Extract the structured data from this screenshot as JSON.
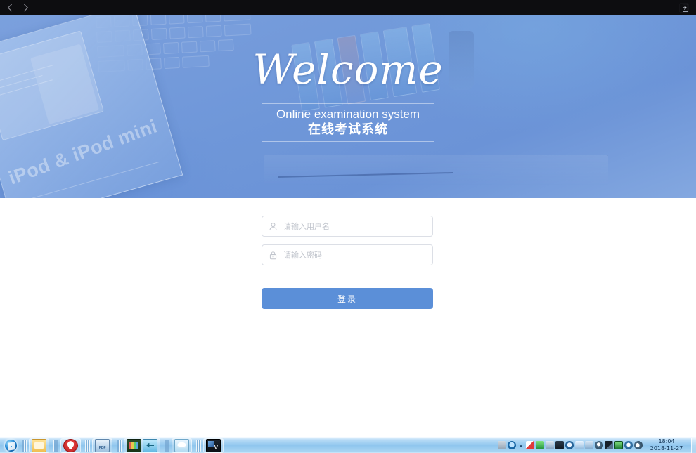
{
  "topbar": {
    "back_icon": "chevron-left-icon",
    "forward_icon": "chevron-right-icon",
    "exit_icon": "exit-fullscreen-icon"
  },
  "hero": {
    "welcome_script": "Welcome",
    "title_en": "Online examination system",
    "title_cn": "在线考试系统",
    "background_color": "#6f96d8",
    "photo_text": "iPod & iPod mini"
  },
  "login": {
    "username": {
      "icon": "user-icon",
      "value": "",
      "placeholder": "请输入用户名"
    },
    "password": {
      "icon": "lock-icon",
      "value": "",
      "placeholder": "请输入密码"
    },
    "submit_label": "登录",
    "accent_color": "#5b8fd8"
  },
  "taskbar": {
    "start_icon": "windows-start-orb-icon",
    "quick_launch": [
      {
        "name": "file-explorer-icon",
        "label": ""
      },
      {
        "name": "antivirus-icon",
        "label": ""
      },
      {
        "name": "pdf-reader-icon",
        "label": "PDF"
      },
      {
        "name": "video-editor-icon",
        "label": ""
      },
      {
        "name": "network-tool-icon",
        "label": ""
      },
      {
        "name": "cloud-storage-icon",
        "label": ""
      },
      {
        "name": "dark-app-icon",
        "label": "V"
      }
    ],
    "tray_icons": [
      "tray-hidden-icon",
      "help-icon",
      "sound-mixer-icon",
      "red-marker-icon",
      "usb-device-icon",
      "printer-icon",
      "display-icon",
      "update-icon",
      "mail-icon",
      "globe-icon",
      "bird-icon",
      "screen-capture-icon",
      "input-method-icon",
      "volume-icon"
    ],
    "clock": {
      "time": "18:04",
      "date": "2018-11-27"
    }
  }
}
